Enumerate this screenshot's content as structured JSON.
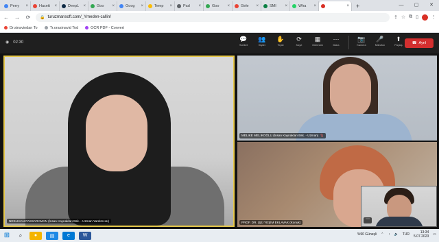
{
  "browser": {
    "tabs": [
      {
        "label": "Perry",
        "color": "#4285f4"
      },
      {
        "label": "Hacett",
        "color": "#ea4335"
      },
      {
        "label": "DeepL",
        "color": "#0f2b46"
      },
      {
        "label": "Goo",
        "color": "#34a853"
      },
      {
        "label": "Goog",
        "color": "#4285f4"
      },
      {
        "label": "Temp",
        "color": "#fbbc04"
      },
      {
        "label": "Pad",
        "color": "#5f6368"
      },
      {
        "label": "Goo",
        "color": "#34a853"
      },
      {
        "label": "Gele",
        "color": "#ea4335"
      },
      {
        "label": "SMI",
        "color": "#0b8043"
      },
      {
        "label": "Wha",
        "color": "#25d366"
      },
      {
        "label": "",
        "color": "#d93025"
      }
    ],
    "url": "turuzmansoft.com/_Ymeden-callin/",
    "bookmarks": [
      {
        "label": "Dr.sinavindan To",
        "color": "#ea4335"
      },
      {
        "label": "Tr.orasinavid Tod",
        "color": "#9aa0a6"
      },
      {
        "label": "OCR PDF - Convert",
        "color": "#a142f4"
      }
    ]
  },
  "meeting": {
    "timer": "02:30",
    "tools": [
      {
        "icon": "chat-icon",
        "glyph": "💬",
        "label": "Sohbet"
      },
      {
        "icon": "people-icon",
        "glyph": "👥",
        "label": "Kişiler"
      },
      {
        "icon": "hand-icon",
        "glyph": "✋",
        "label": "Tepki"
      },
      {
        "icon": "rooms-icon",
        "glyph": "⟳",
        "label": "Kayıt"
      },
      {
        "icon": "view-icon",
        "glyph": "▦",
        "label": "Görünüm"
      },
      {
        "icon": "more-icon",
        "glyph": "⋯",
        "label": "Daha"
      }
    ],
    "media": [
      {
        "icon": "camera-icon",
        "glyph": "📷",
        "label": "Kamera"
      },
      {
        "icon": "mic-icon",
        "glyph": "🎤",
        "label": "Mikrofon"
      },
      {
        "icon": "share-icon",
        "glyph": "⬆",
        "label": "Paylaş"
      }
    ],
    "leave_label": "Ayrıl"
  },
  "participants": {
    "main": "NESLIHAN PASSARAMAN (İnsan Kaynakları Bsk. - Uzman Yardımcısı)",
    "top_right": "MELIKE MELİKOĞLU (İnsan Kaynakları Bsk. - Uzman)",
    "bottom_right": "PROF. DR. (ŞÜ YEŞİM EKLAVAK (Konuk)",
    "self": ""
  },
  "taskbar": {
    "tray_text": "%90 Güneşli",
    "lang": "TUR",
    "time": "13:34",
    "date": "5.07.2023"
  }
}
